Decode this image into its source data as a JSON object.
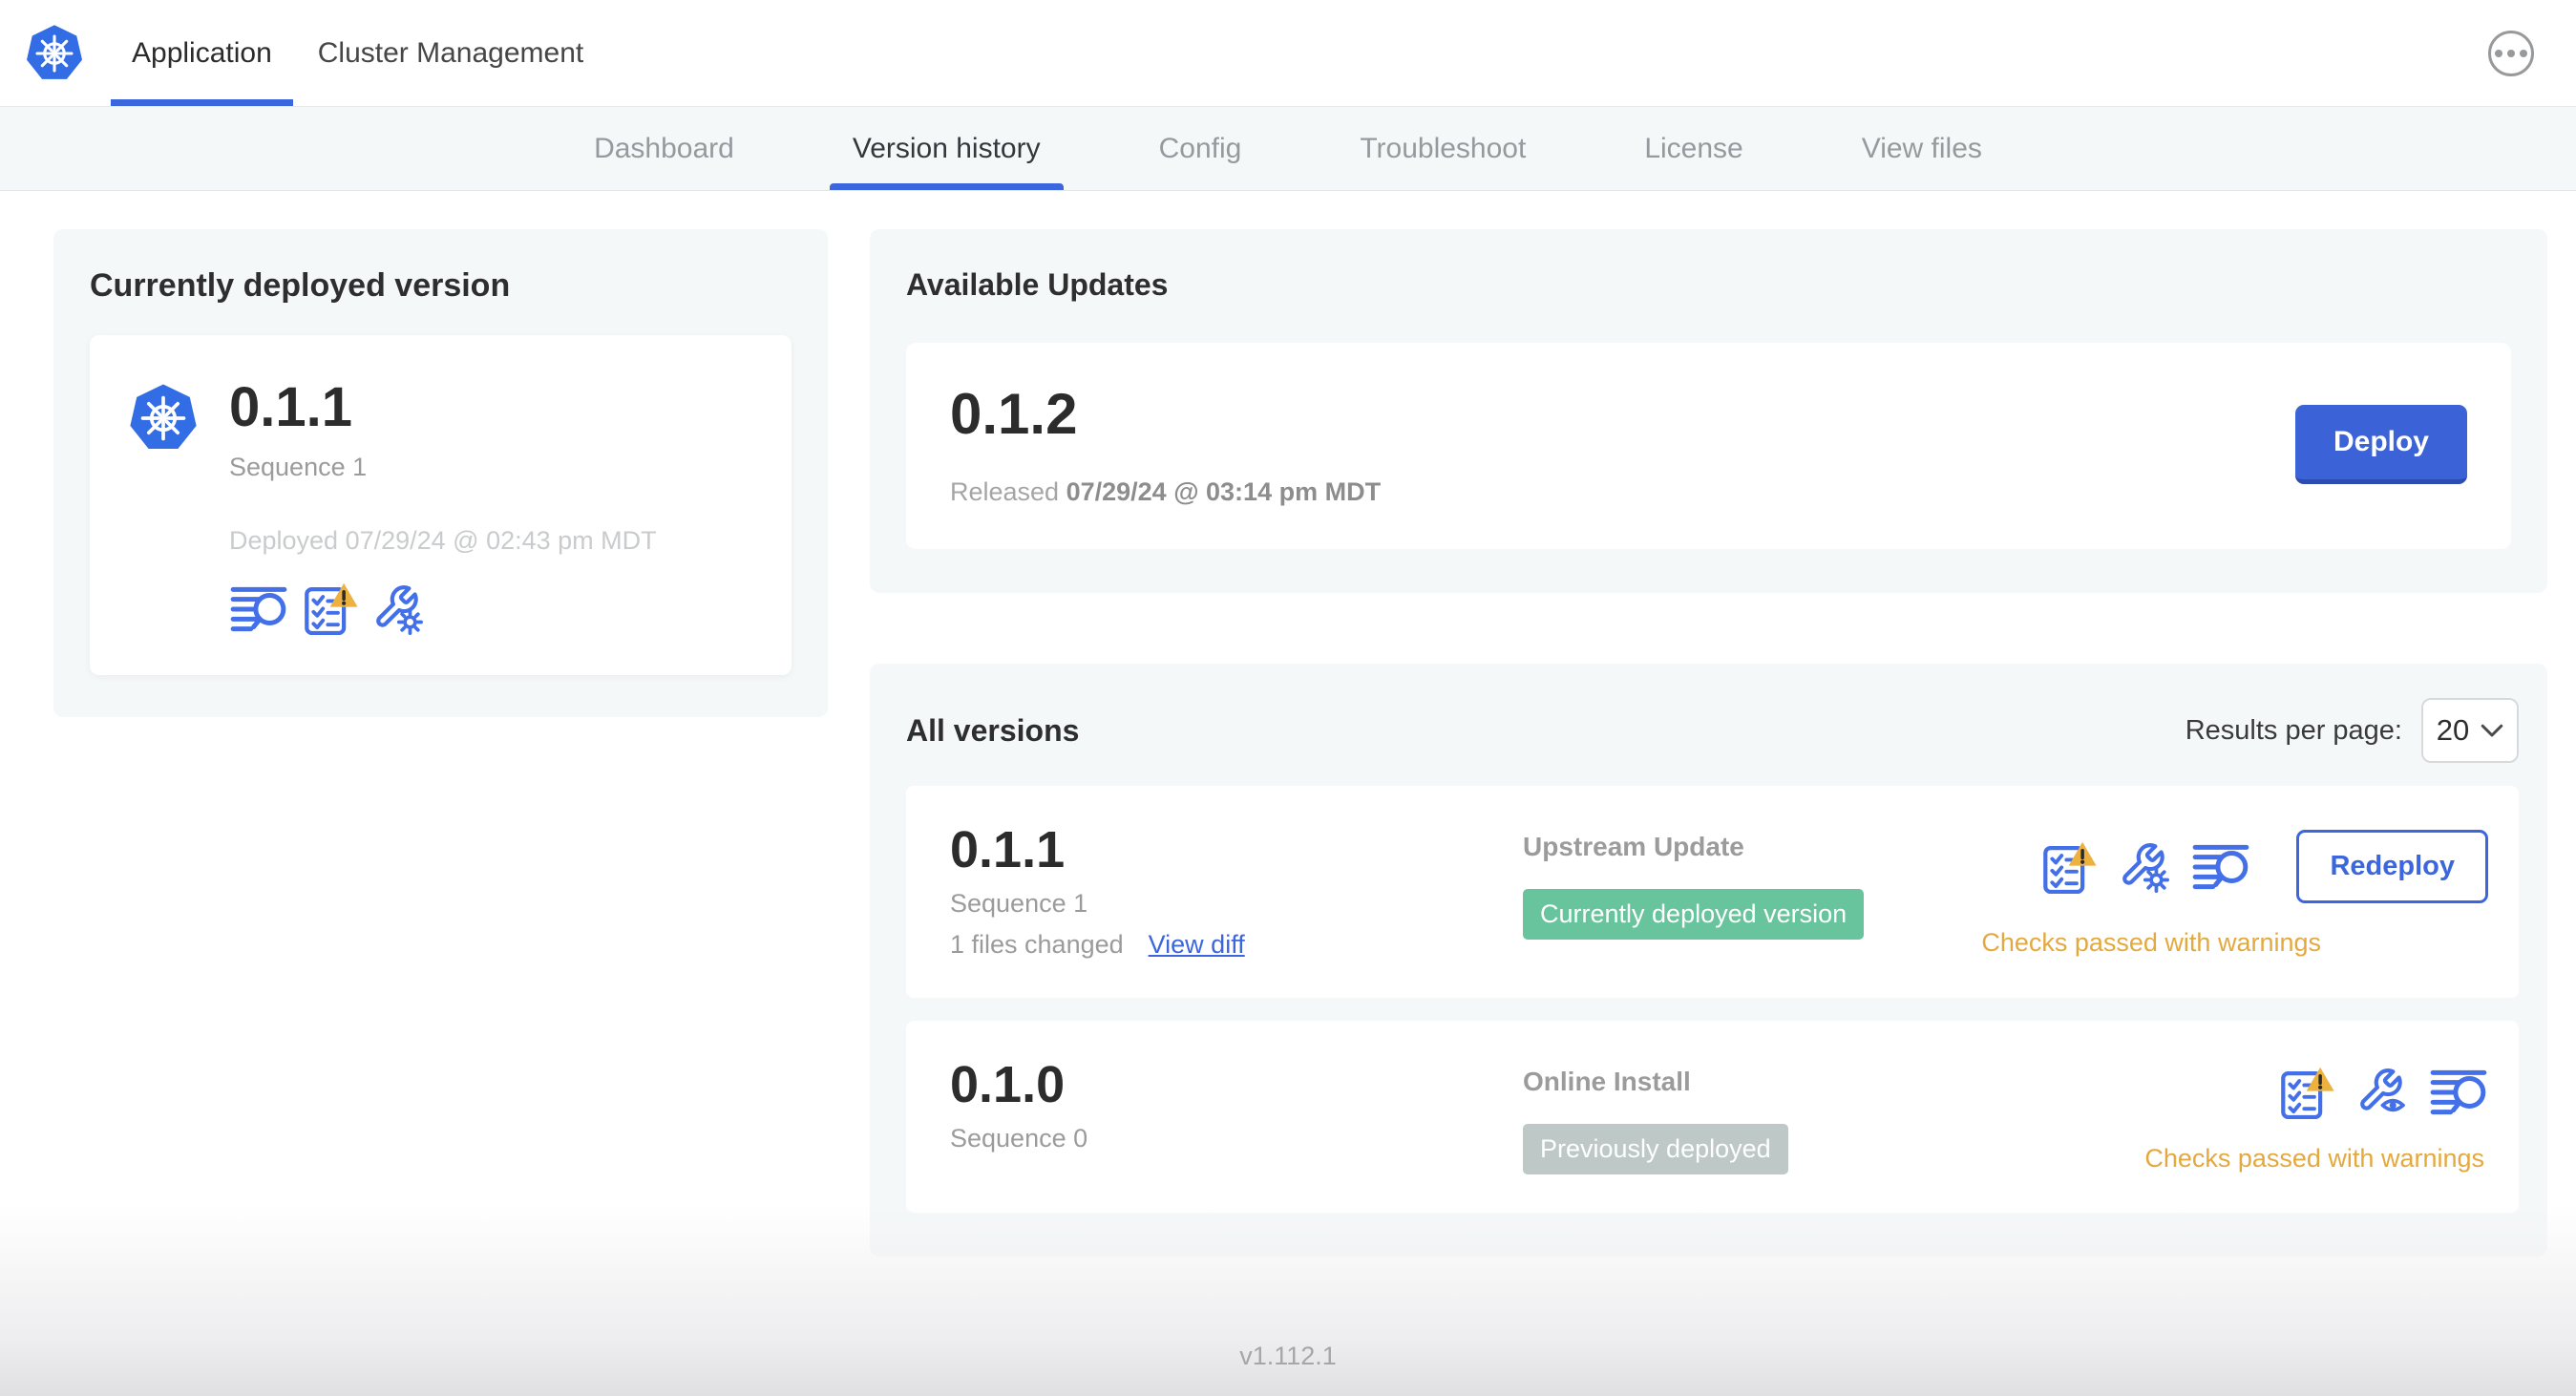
{
  "header": {
    "tabs": [
      {
        "label": "Application",
        "active": true
      },
      {
        "label": "Cluster Management",
        "active": false
      }
    ]
  },
  "subnav": {
    "tabs": [
      {
        "label": "Dashboard",
        "active": false
      },
      {
        "label": "Version history",
        "active": true
      },
      {
        "label": "Config",
        "active": false
      },
      {
        "label": "Troubleshoot",
        "active": false
      },
      {
        "label": "License",
        "active": false
      },
      {
        "label": "View files",
        "active": false
      }
    ]
  },
  "current_version_card": {
    "title": "Currently deployed version",
    "version": "0.1.1",
    "sequence": "Sequence 1",
    "deployed": "Deployed 07/29/24 @ 02:43 pm MDT"
  },
  "available_updates": {
    "title": "Available Updates",
    "version": "0.1.2",
    "released_prefix": "Released",
    "released_date": "07/29/24 @ 03:14 pm MDT",
    "deploy_label": "Deploy"
  },
  "all_versions": {
    "title": "All versions",
    "results_per_page_label": "Results per page:",
    "results_per_page_value": "20",
    "rows": [
      {
        "version": "0.1.1",
        "sequence": "Sequence 1",
        "files_changed": "1 files changed",
        "view_diff": "View diff",
        "source": "Upstream Update",
        "badge": "Currently deployed version",
        "badge_color": "#68c49c",
        "checks": "Checks passed with warnings",
        "action": "Redeploy"
      },
      {
        "version": "0.1.0",
        "sequence": "Sequence 0",
        "source": "Online Install",
        "badge": "Previously deployed",
        "badge_color": "#bec8c6",
        "checks": "Checks passed with warnings"
      }
    ]
  },
  "footer": {
    "app_version": "v1.112.1"
  },
  "colors": {
    "accent_blue": "#3b66de",
    "icon_blue": "#4370e8",
    "kubernetes_blue": "#326de6",
    "warning_amber": "#e4a93e",
    "badge_green": "#68c49c",
    "badge_gray": "#bec8c6",
    "panel_gray": "#f5f8f9"
  }
}
